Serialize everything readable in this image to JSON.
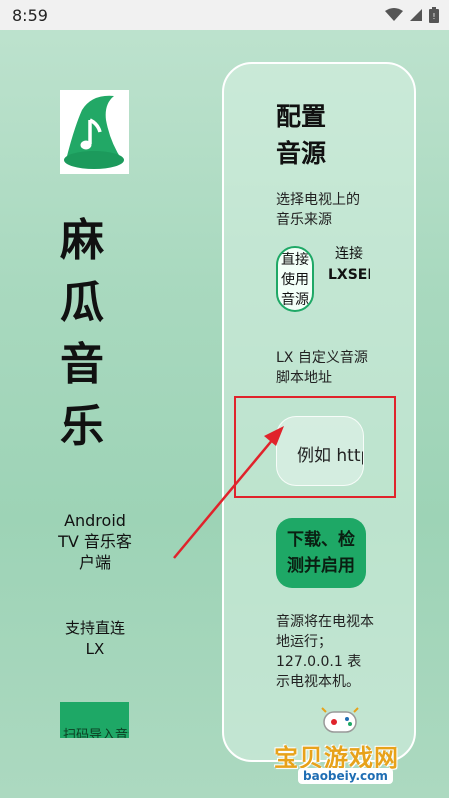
{
  "status_bar": {
    "time": "8:59"
  },
  "app": {
    "title_chars": [
      "麻",
      "瓜",
      "音",
      "乐"
    ],
    "description": "Android TV 音乐客户端",
    "note": "支持直连 LX",
    "import_button": "扫码导入音源"
  },
  "panel": {
    "title": "配置音源",
    "subtitle": "选择电视上的音乐来源",
    "option_direct": "直接使用音源",
    "option_lx_prefix": "连接",
    "option_lx_name": "LXSERVER",
    "custom_label": "LX 自定义音源脚本地址",
    "script_input_placeholder": "例如 https://",
    "download_button": "下载、检测并启用",
    "foot_note": "音源将在电视本地运行；127.0.0.1 表示电视本机。"
  },
  "watermark": {
    "text": "宝贝游戏网",
    "url": "baobeiy.com"
  },
  "colors": {
    "accent": "#1ea866",
    "annotation": "#e0232b",
    "watermark": "#e7a21a"
  }
}
